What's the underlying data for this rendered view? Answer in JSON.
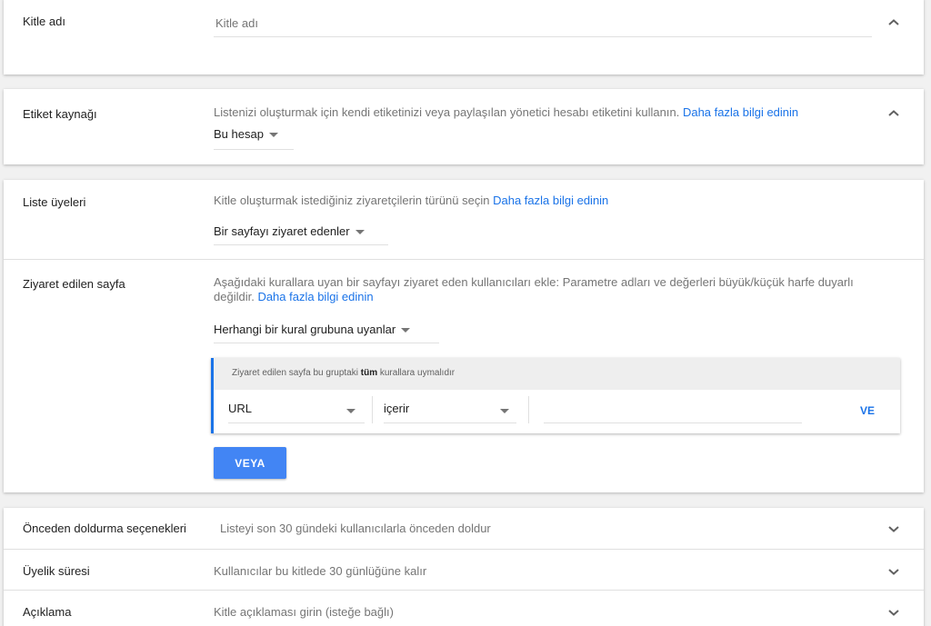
{
  "audience_name": {
    "label": "Kitle adı",
    "placeholder": "Kitle adı"
  },
  "tag_source": {
    "label": "Etiket kaynağı",
    "description": "Listenizi oluşturmak için kendi etiketinizi veya paylaşılan yönetici hesabı etiketini kullanın.",
    "learn_more": "Daha fazla bilgi edinin",
    "selected": "Bu hesap"
  },
  "list_members": {
    "label": "Liste üyeleri",
    "description": "Kitle oluşturmak istediğiniz ziyaretçilerin türünü seçin",
    "learn_more": "Daha fazla bilgi edinin",
    "selected": "Bir sayfayı ziyaret edenler"
  },
  "visited_page": {
    "label": "Ziyaret edilen sayfa",
    "description": "Aşağıdaki kurallara uyan bir sayfayı ziyaret eden kullanıcıları ekle: Parametre adları ve değerleri büyük/küçük harfe duyarlı değildir.",
    "learn_more": "Daha fazla bilgi edinin",
    "rule_group_select": "Herhangi bir kural grubuna uyanlar",
    "rule_group": {
      "header_prefix": "Ziyaret edilen sayfa bu gruptaki",
      "header_bold": "tüm",
      "header_suffix": "kurallara uymalıdır",
      "field": "URL",
      "operator": "içerir",
      "value": "",
      "and_button": "VE"
    },
    "or_button": "VEYA"
  },
  "prefill": {
    "label": "Önceden doldurma seçenekleri",
    "summary": "Listeyi son 30 gündeki kullanıcılarla önceden doldur"
  },
  "membership": {
    "label": "Üyelik süresi",
    "summary": "Kullanıcılar bu kitlede 30 günlüğüne kalır"
  },
  "description": {
    "label": "Açıklama",
    "summary": "Kitle açıklaması girin (isteğe bağlı)"
  },
  "colors": {
    "accent": "#1a73e8",
    "button": "#4285f4"
  }
}
